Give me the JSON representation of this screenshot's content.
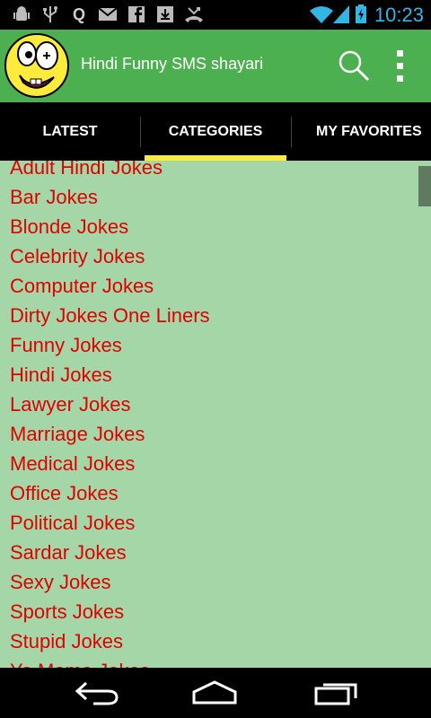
{
  "status_bar": {
    "time": "10:23",
    "left_icons": [
      "android-debug-icon",
      "usb-icon",
      "q-icon",
      "mail-icon",
      "facebook-icon",
      "download-icon",
      "missed-call-icon"
    ],
    "right_icons": [
      "wifi-icon",
      "signal-icon",
      "battery-charging-icon"
    ]
  },
  "action_bar": {
    "title": "Hindi Funny SMS shayari",
    "logo_icon": "smiley-face-icon",
    "search_icon": "search-icon",
    "overflow_icon": "overflow-menu-icon",
    "background": "#4caf50"
  },
  "tabs": [
    {
      "label": "LATEST",
      "selected": false
    },
    {
      "label": "CATEGORIES",
      "selected": true
    },
    {
      "label": "MY FAVORITES",
      "selected": false
    }
  ],
  "categories": [
    "Adult Hindi Jokes",
    "Bar Jokes",
    "Blonde Jokes",
    "Celebrity Jokes",
    "Computer Jokes",
    "Dirty Jokes One Liners",
    "Funny Jokes",
    "Hindi Jokes",
    "Lawyer Jokes",
    "Marriage Jokes",
    "Medical Jokes",
    "Office Jokes",
    "Political Jokes",
    "Sardar Jokes",
    "Sexy Jokes",
    "Sports Jokes",
    "Stupid Jokes",
    "Yo Mama Jokes"
  ],
  "nav_bar": {
    "icons": [
      "back-icon",
      "home-icon",
      "recent-apps-icon"
    ]
  },
  "colors": {
    "list_background": "#a5d6a7",
    "list_text": "#e00000",
    "tab_indicator": "#ffeb3b"
  }
}
